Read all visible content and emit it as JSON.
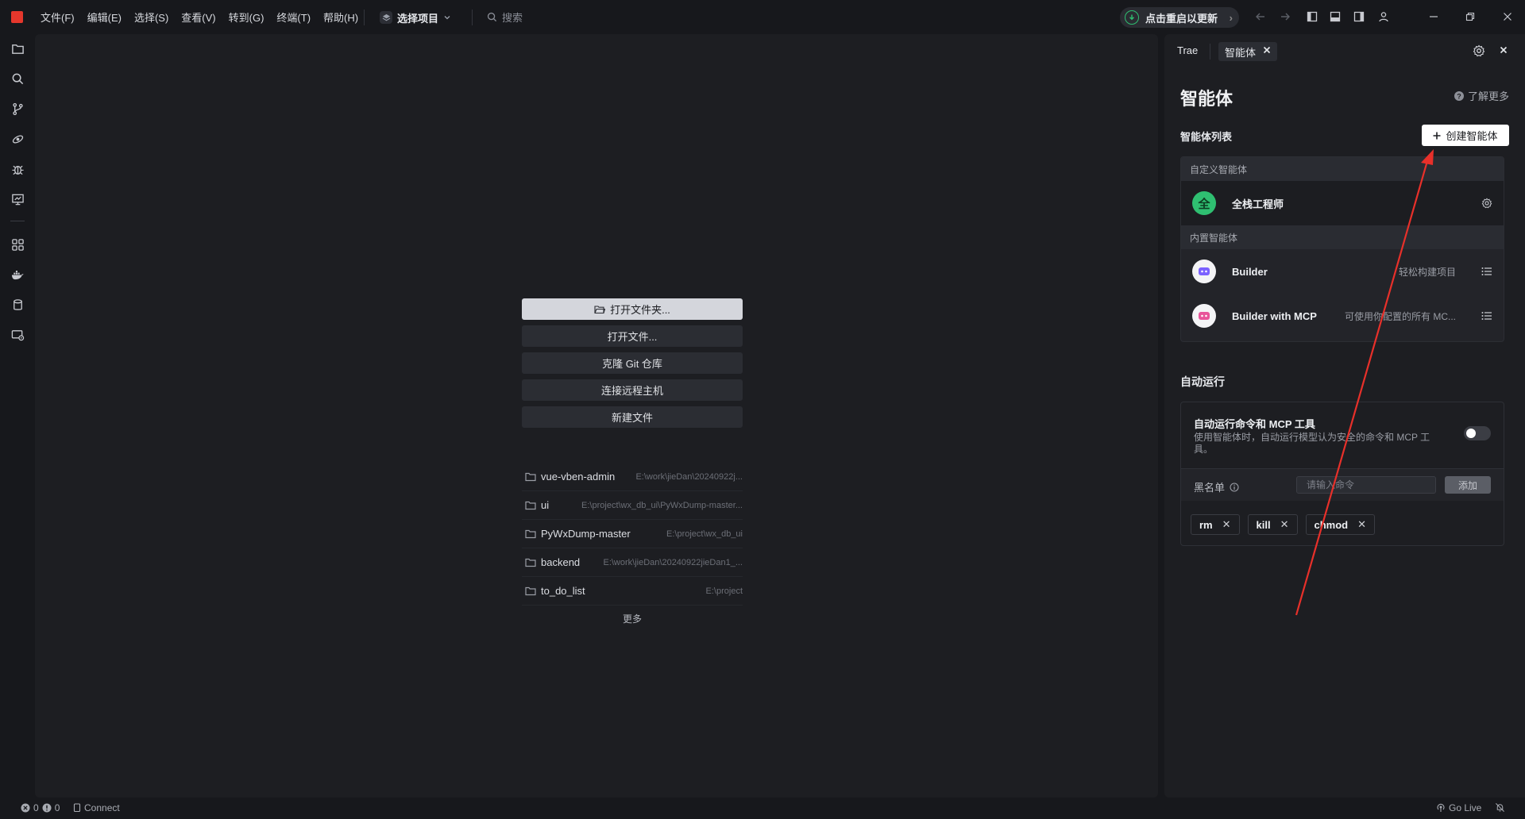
{
  "menu": [
    "文件(F)",
    "编辑(E)",
    "选择(S)",
    "查看(V)",
    "转到(G)",
    "终端(T)",
    "帮助(H)"
  ],
  "project_select": "选择项目",
  "search_placeholder": "搜索",
  "update_button": "点击重启以更新",
  "welcome": {
    "buttons": [
      "打开文件夹...",
      "打开文件...",
      "克隆 Git 仓库",
      "连接远程主机",
      "新建文件"
    ],
    "recent": [
      {
        "name": "vue-vben-admin",
        "path": "E:\\work\\jieDan\\20240922j..."
      },
      {
        "name": "ui",
        "path": "E:\\project\\wx_db_ui\\PyWxDump-master..."
      },
      {
        "name": "PyWxDump-master",
        "path": "E:\\project\\wx_db_ui"
      },
      {
        "name": "backend",
        "path": "E:\\work\\jieDan\\20240922jieDan1_..."
      },
      {
        "name": "to_do_list",
        "path": "E:\\project"
      }
    ],
    "more": "更多"
  },
  "panel": {
    "tab_trae": "Trae",
    "tab_agent": "智能体",
    "title": "智能体",
    "learn_more": "了解更多",
    "list_label": "智能体列表",
    "create_button": "创建智能体",
    "custom_section": "自定义智能体",
    "builtin_section": "内置智能体",
    "custom_agents": [
      {
        "name": "全栈工程师",
        "avatar": "全"
      }
    ],
    "builtin_agents": [
      {
        "name": "Builder",
        "desc": "轻松构建项目"
      },
      {
        "name": "Builder with MCP",
        "desc": "可使用你配置的所有 MC..."
      }
    ],
    "auto_run_label": "自动运行",
    "auto_run_title": "自动运行命令和 MCP 工具",
    "auto_run_desc": "使用智能体时，自动运行模型认为安全的命令和 MCP 工具。",
    "blacklist_label": "黑名单",
    "blacklist_placeholder": "请输入命令",
    "add_button": "添加",
    "blacklist": [
      "rm",
      "kill",
      "chmod"
    ]
  },
  "status": {
    "errors": "0",
    "warnings": "0",
    "connect": "Connect",
    "go_live": "Go Live"
  },
  "colors": {
    "accent_red": "#e5372c",
    "annotation_arrow": "#e8302a",
    "update_green": "#2fbf71",
    "agent_avatar_green": "#2fbf71"
  }
}
